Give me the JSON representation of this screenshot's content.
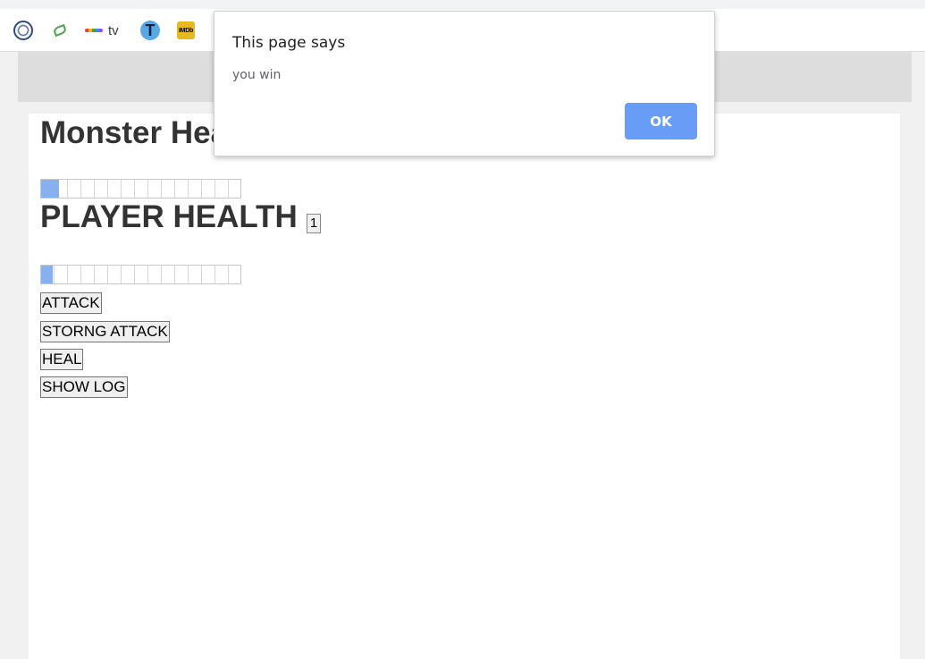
{
  "bookmarks_bar": {
    "items": [
      {
        "icon": "circular-seal-icon"
      },
      {
        "icon": "leaf-icon"
      },
      {
        "icon": "colored-dots-icon",
        "label": "tv"
      },
      {
        "icon": "t-letter-icon",
        "glyph": "T"
      },
      {
        "icon": "imdb-icon",
        "glyph": "IMDb"
      }
    ]
  },
  "game": {
    "monster_title": "Monster Hea",
    "monster_health_fraction": 0.09,
    "player_title": "PLAYER HEALTH",
    "player_count": "1",
    "player_health_fraction": 0.06,
    "buttons": {
      "attack": "ATTACK",
      "strong_attack": "STORNG ATTACK",
      "heal": "HEAL",
      "show_log": "SHOW LOG"
    }
  },
  "dialog": {
    "title": "This page says",
    "message": "you win",
    "ok_label": "OK"
  },
  "colors": {
    "health_fill": "#86b0f0",
    "dialog_button": "#679df6"
  }
}
